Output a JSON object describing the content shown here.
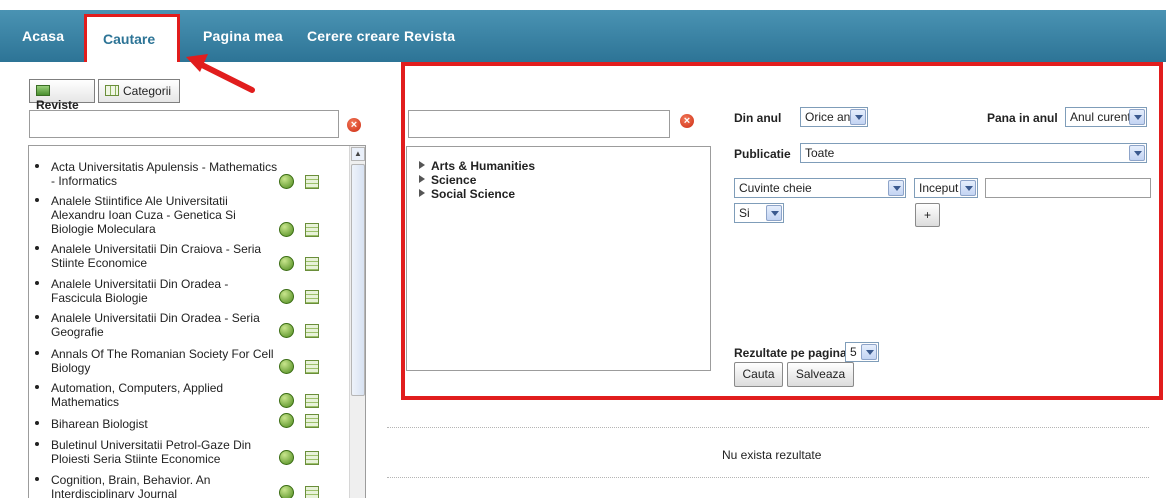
{
  "nav": {
    "items": [
      "Acasa",
      "Cautare",
      "Pagina mea",
      "Cerere creare Revista"
    ],
    "active_index": 1,
    "accent": "#2d7496",
    "highlight": "#e11d1d"
  },
  "left": {
    "tabs": [
      "Reviste",
      "Categorii"
    ],
    "search": {
      "value": "",
      "placeholder": ""
    },
    "journals": [
      "Acta Universitatis Apulensis - Mathematics - Informatics",
      "Analele Stiintifice Ale Universitatii Alexandru Ioan Cuza - Genetica Si Biologie Moleculara",
      "Analele Universitatii Din Craiova - Seria Stiinte Economice",
      "Analele Universitatii Din Oradea - Fascicula Biologie",
      "Analele Universitatii Din Oradea - Seria Geografie",
      "Annals Of The Romanian Society For Cell Biology",
      "Automation, Computers, Applied Mathematics",
      "Biharean Biologist",
      "Buletinul Universitatii Petrol-Gaze Din Ploiesti Seria Stiinte Economice",
      "Cognition, Brain, Behavior. An Interdisciplinary Journal"
    ]
  },
  "categories": {
    "search": {
      "value": "",
      "placeholder": ""
    },
    "items": [
      "Arts & Humanities",
      "Science",
      "Social Science"
    ]
  },
  "filters": {
    "from_year_label": "Din anul",
    "from_year_value": "Orice an",
    "to_year_label": "Pana in anul",
    "to_year_value": "Anul curent",
    "publication_label": "Publicatie",
    "publication_value": "Toate",
    "field_value": "Cuvinte cheie",
    "match_value": "Inceput",
    "term_value": "",
    "operator_value": "Si",
    "add_label": "+",
    "per_page_label": "Rezultate pe pagina",
    "per_page_value": "5",
    "search_label": "Cauta",
    "save_label": "Salveaza"
  },
  "results": {
    "empty_text": "Nu exista rezultate"
  }
}
